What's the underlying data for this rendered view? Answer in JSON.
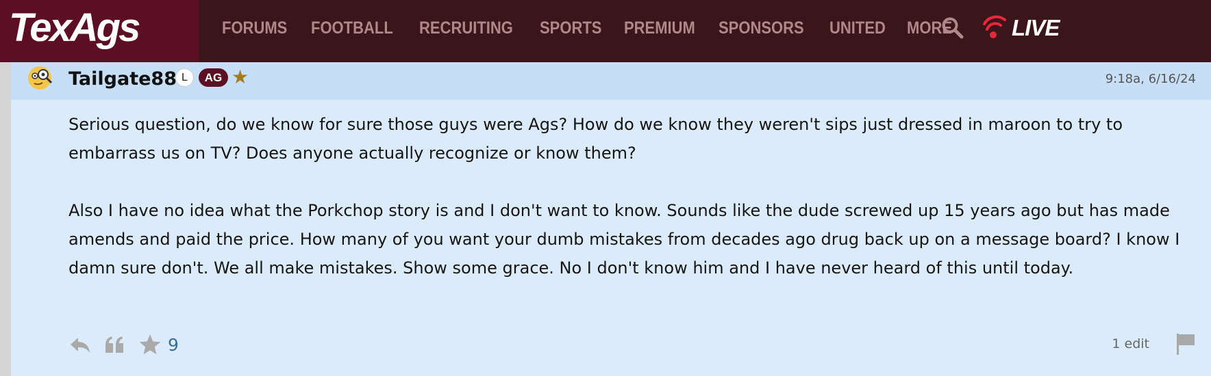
{
  "brand": {
    "logo_text": "TexAgs",
    "logo_bg": "#5b0e24",
    "nav_bg": "#3a1519"
  },
  "nav": {
    "items": [
      "FORUMS",
      "FOOTBALL",
      "RECRUITING",
      "SPORTS",
      "PREMIUM",
      "SPONSORS",
      "UNITED",
      "MORE"
    ],
    "search_icon": "search-icon",
    "live_label": "LIVE",
    "live_icon": "wifi-broadcast-icon",
    "live_color": "#e8283a"
  },
  "post": {
    "username": "Tailgate88",
    "badges": {
      "level": "L",
      "affiliation": "AG",
      "star_icon": "star-icon"
    },
    "timestamp": "9:18a, 6/16/24",
    "paragraphs": [
      "Serious question, do we know for sure those guys were Ags? How do we know they weren't sips just dressed in maroon to try to embarrass us on TV? Does anyone actually recognize or know them?",
      "Also I have no idea what the Porkchop story is and I don't want to know. Sounds like the dude screwed up 15 years ago but has made amends and paid the price. How many of you want your dumb mistakes from decades ago drug back up on a message board? I know I damn sure don't. We all make mistakes. Show some grace. No I don't know him and I have never heard of this until today."
    ],
    "star_count": "9",
    "edit_count": "1 edit",
    "colors": {
      "header_bg": "#c6def6",
      "body_bg": "#dcebfa",
      "star_count": "#3a6e99"
    }
  }
}
